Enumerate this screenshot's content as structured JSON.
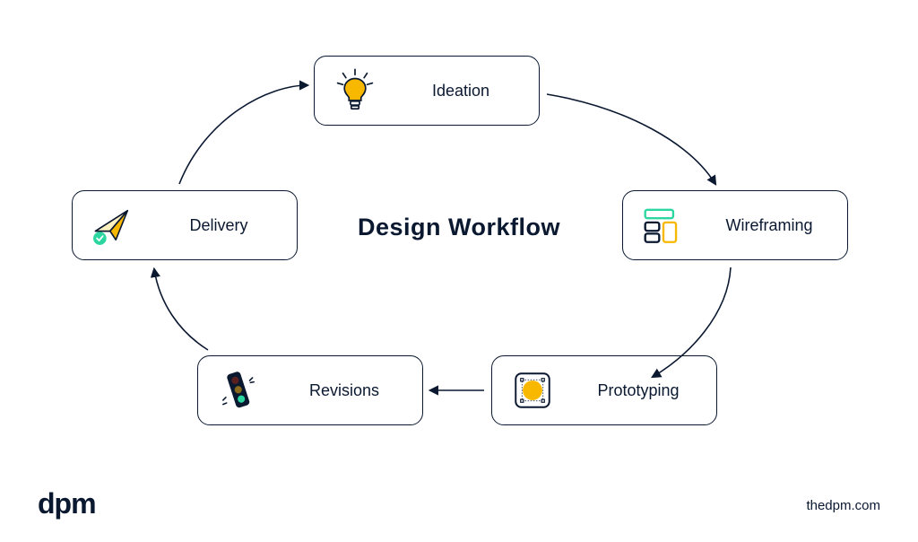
{
  "diagram": {
    "title": "Design Workflow",
    "nodes": {
      "ideation": {
        "label": "Ideation",
        "icon": "lightbulb-icon"
      },
      "wireframing": {
        "label": "Wireframing",
        "icon": "wireframe-icon"
      },
      "prototyping": {
        "label": "Prototyping",
        "icon": "prototype-icon"
      },
      "revisions": {
        "label": "Revisions",
        "icon": "traffic-light-icon"
      },
      "delivery": {
        "label": "Delivery",
        "icon": "paper-plane-icon"
      }
    }
  },
  "footer": {
    "logo_text": "dpm",
    "site": "thedpm.com"
  },
  "colors": {
    "stroke": "#0a1830",
    "yellow": "#f9b800",
    "teal": "#2bd6a1",
    "dark": "#0a1830"
  }
}
